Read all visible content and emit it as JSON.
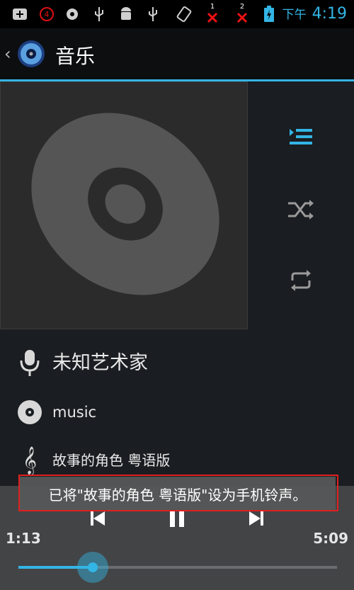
{
  "status_bar": {
    "icons": [
      "add-notification-icon",
      "badge-4-icon",
      "sync-icon",
      "usb-icon",
      "android-debug-icon",
      "usb-icon",
      "rotate-icon",
      "no-signal-1-icon",
      "no-signal-2-icon",
      "battery-charging-icon"
    ],
    "badge_count": "4",
    "sim1_label": "1",
    "sim2_label": "2",
    "ampm": "下午",
    "time": "4:19"
  },
  "header": {
    "title": "音乐"
  },
  "track": {
    "artist": "未知艺术家",
    "album": "music",
    "title": "故事的角色 粤语版"
  },
  "toast": {
    "message": "已将\"故事的角色 粤语版\"设为手机铃声。"
  },
  "player": {
    "elapsed": "1:13",
    "duration": "5:09",
    "progress": 0.233
  },
  "colors": {
    "accent": "#33b5e5",
    "toast_border": "#e02020"
  }
}
